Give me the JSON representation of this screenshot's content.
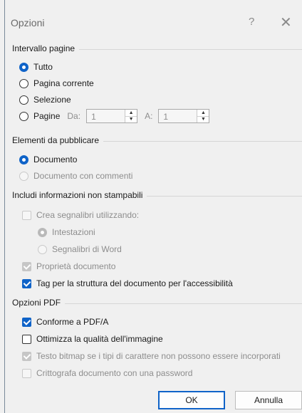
{
  "title": "Opzioni",
  "help_glyph": "?",
  "close_glyph": "✕",
  "sections": {
    "page_range": "Intervallo pagine",
    "publish": "Elementi da pubblicare",
    "nonprint": "Includi informazioni non stampabili",
    "pdf": "Opzioni PDF"
  },
  "page_range": {
    "all": "Tutto",
    "current": "Pagina corrente",
    "selection": "Selezione",
    "pages": "Pagine",
    "from_label": "Da:",
    "from_value": "1",
    "to_label": "A:",
    "to_value": "1"
  },
  "publish": {
    "document": "Documento",
    "document_comments": "Documento con commenti"
  },
  "nonprint": {
    "bookmarks": "Crea segnalibri utilizzando:",
    "headings": "Intestazioni",
    "word_bookmarks": "Segnalibri di Word",
    "doc_properties": "Proprietà documento",
    "accessibility_tags": "Tag per la struttura del documento per l'accessibilità"
  },
  "pdf": {
    "pdfa": "Conforme a PDF/A",
    "optimize": "Ottimizza la qualità dell'immagine",
    "bitmap": "Testo bitmap se i tipi di carattere non possono essere incorporati",
    "encrypt": "Crittografa documento con una password"
  },
  "buttons": {
    "ok": "OK",
    "cancel": "Annulla"
  },
  "colors": {
    "accent": "#0f63c8",
    "disabled_text": "#8d8d8d",
    "background": "#f0f0f0"
  }
}
